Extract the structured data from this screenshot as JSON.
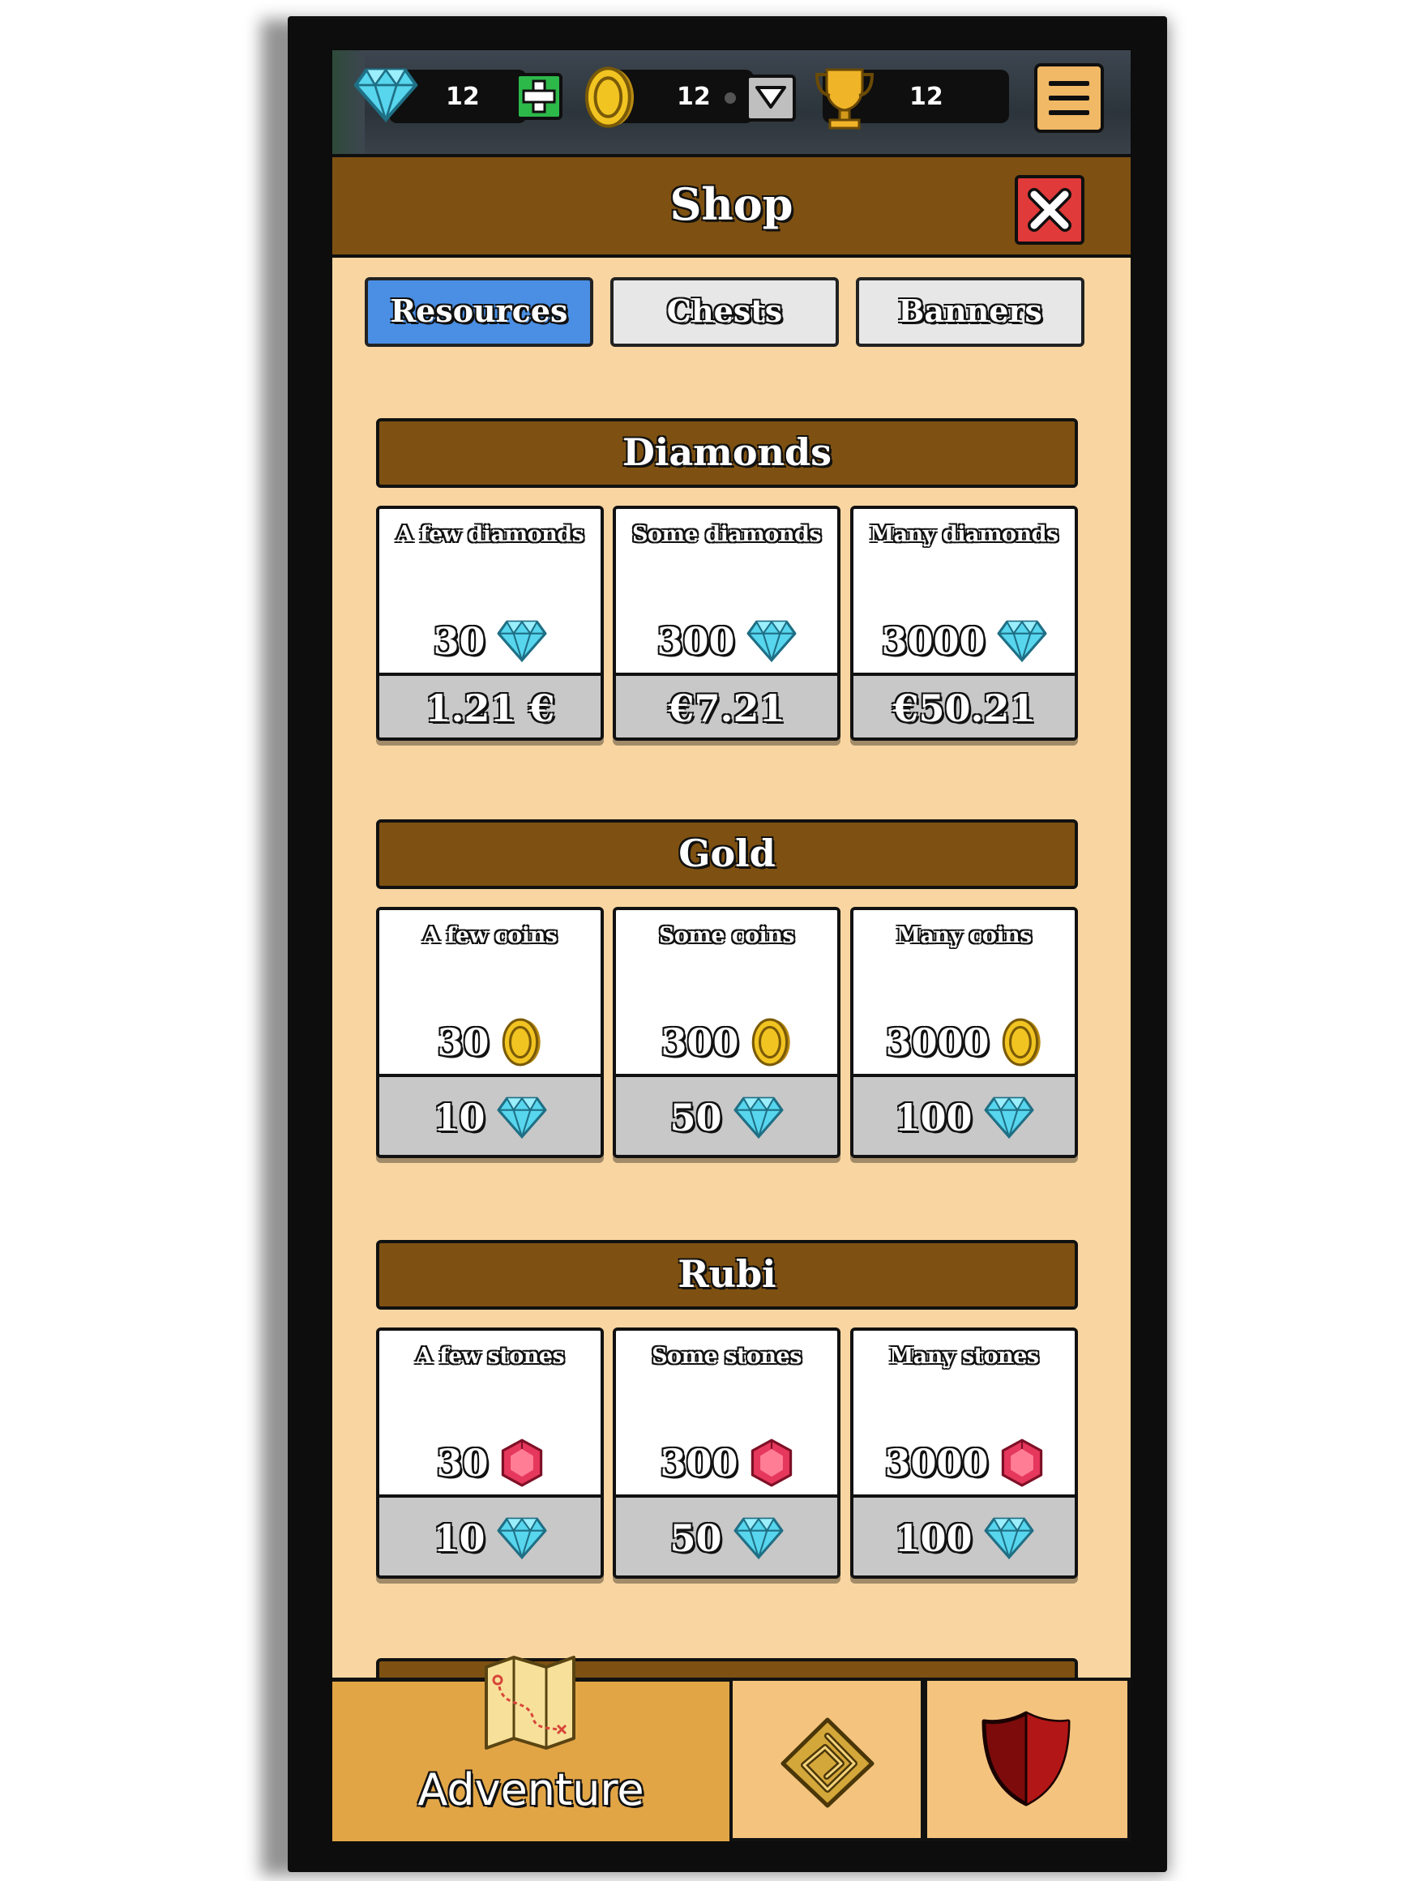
{
  "resources": {
    "diamonds": "12",
    "coins": "12",
    "trophies": "12"
  },
  "shop": {
    "title": "Shop"
  },
  "tabs": [
    {
      "label": "Resources",
      "active": true
    },
    {
      "label": "Chests",
      "active": false
    },
    {
      "label": "Banners",
      "active": false
    }
  ],
  "sections": [
    {
      "title": "Diamonds",
      "items": [
        {
          "name": "A few diamonds",
          "amount": "30",
          "price": "1.21 €"
        },
        {
          "name": "Some diamonds",
          "amount": "300",
          "price": "€7.21"
        },
        {
          "name": "Many diamonds",
          "amount": "3000",
          "price": "€50.21"
        }
      ]
    },
    {
      "title": "Gold",
      "items": [
        {
          "name": "A few coins",
          "amount": "30",
          "price": "10"
        },
        {
          "name": "Some coins",
          "amount": "300",
          "price": "50"
        },
        {
          "name": "Many coins",
          "amount": "3000",
          "price": "100"
        }
      ]
    },
    {
      "title": "Rubi",
      "items": [
        {
          "name": "A few stones",
          "amount": "30",
          "price": "10"
        },
        {
          "name": "Some stones",
          "amount": "300",
          "price": "50"
        },
        {
          "name": "Many stones",
          "amount": "3000",
          "price": "100"
        }
      ]
    }
  ],
  "nav": {
    "adventure_label": "Adventure"
  },
  "colors": {
    "background": "#f9d6a1",
    "header_brown": "#7e5112",
    "active_tab": "#4a8fe4",
    "close_red": "#e03a3a",
    "plus_green": "#2db84a",
    "nav_active": "#e2a546",
    "nav_inactive": "#f4c47f"
  },
  "icons": {
    "diamond": "diamond-icon",
    "coin": "coin-icon",
    "ruby": "ruby-icon",
    "trophy": "trophy-icon"
  }
}
